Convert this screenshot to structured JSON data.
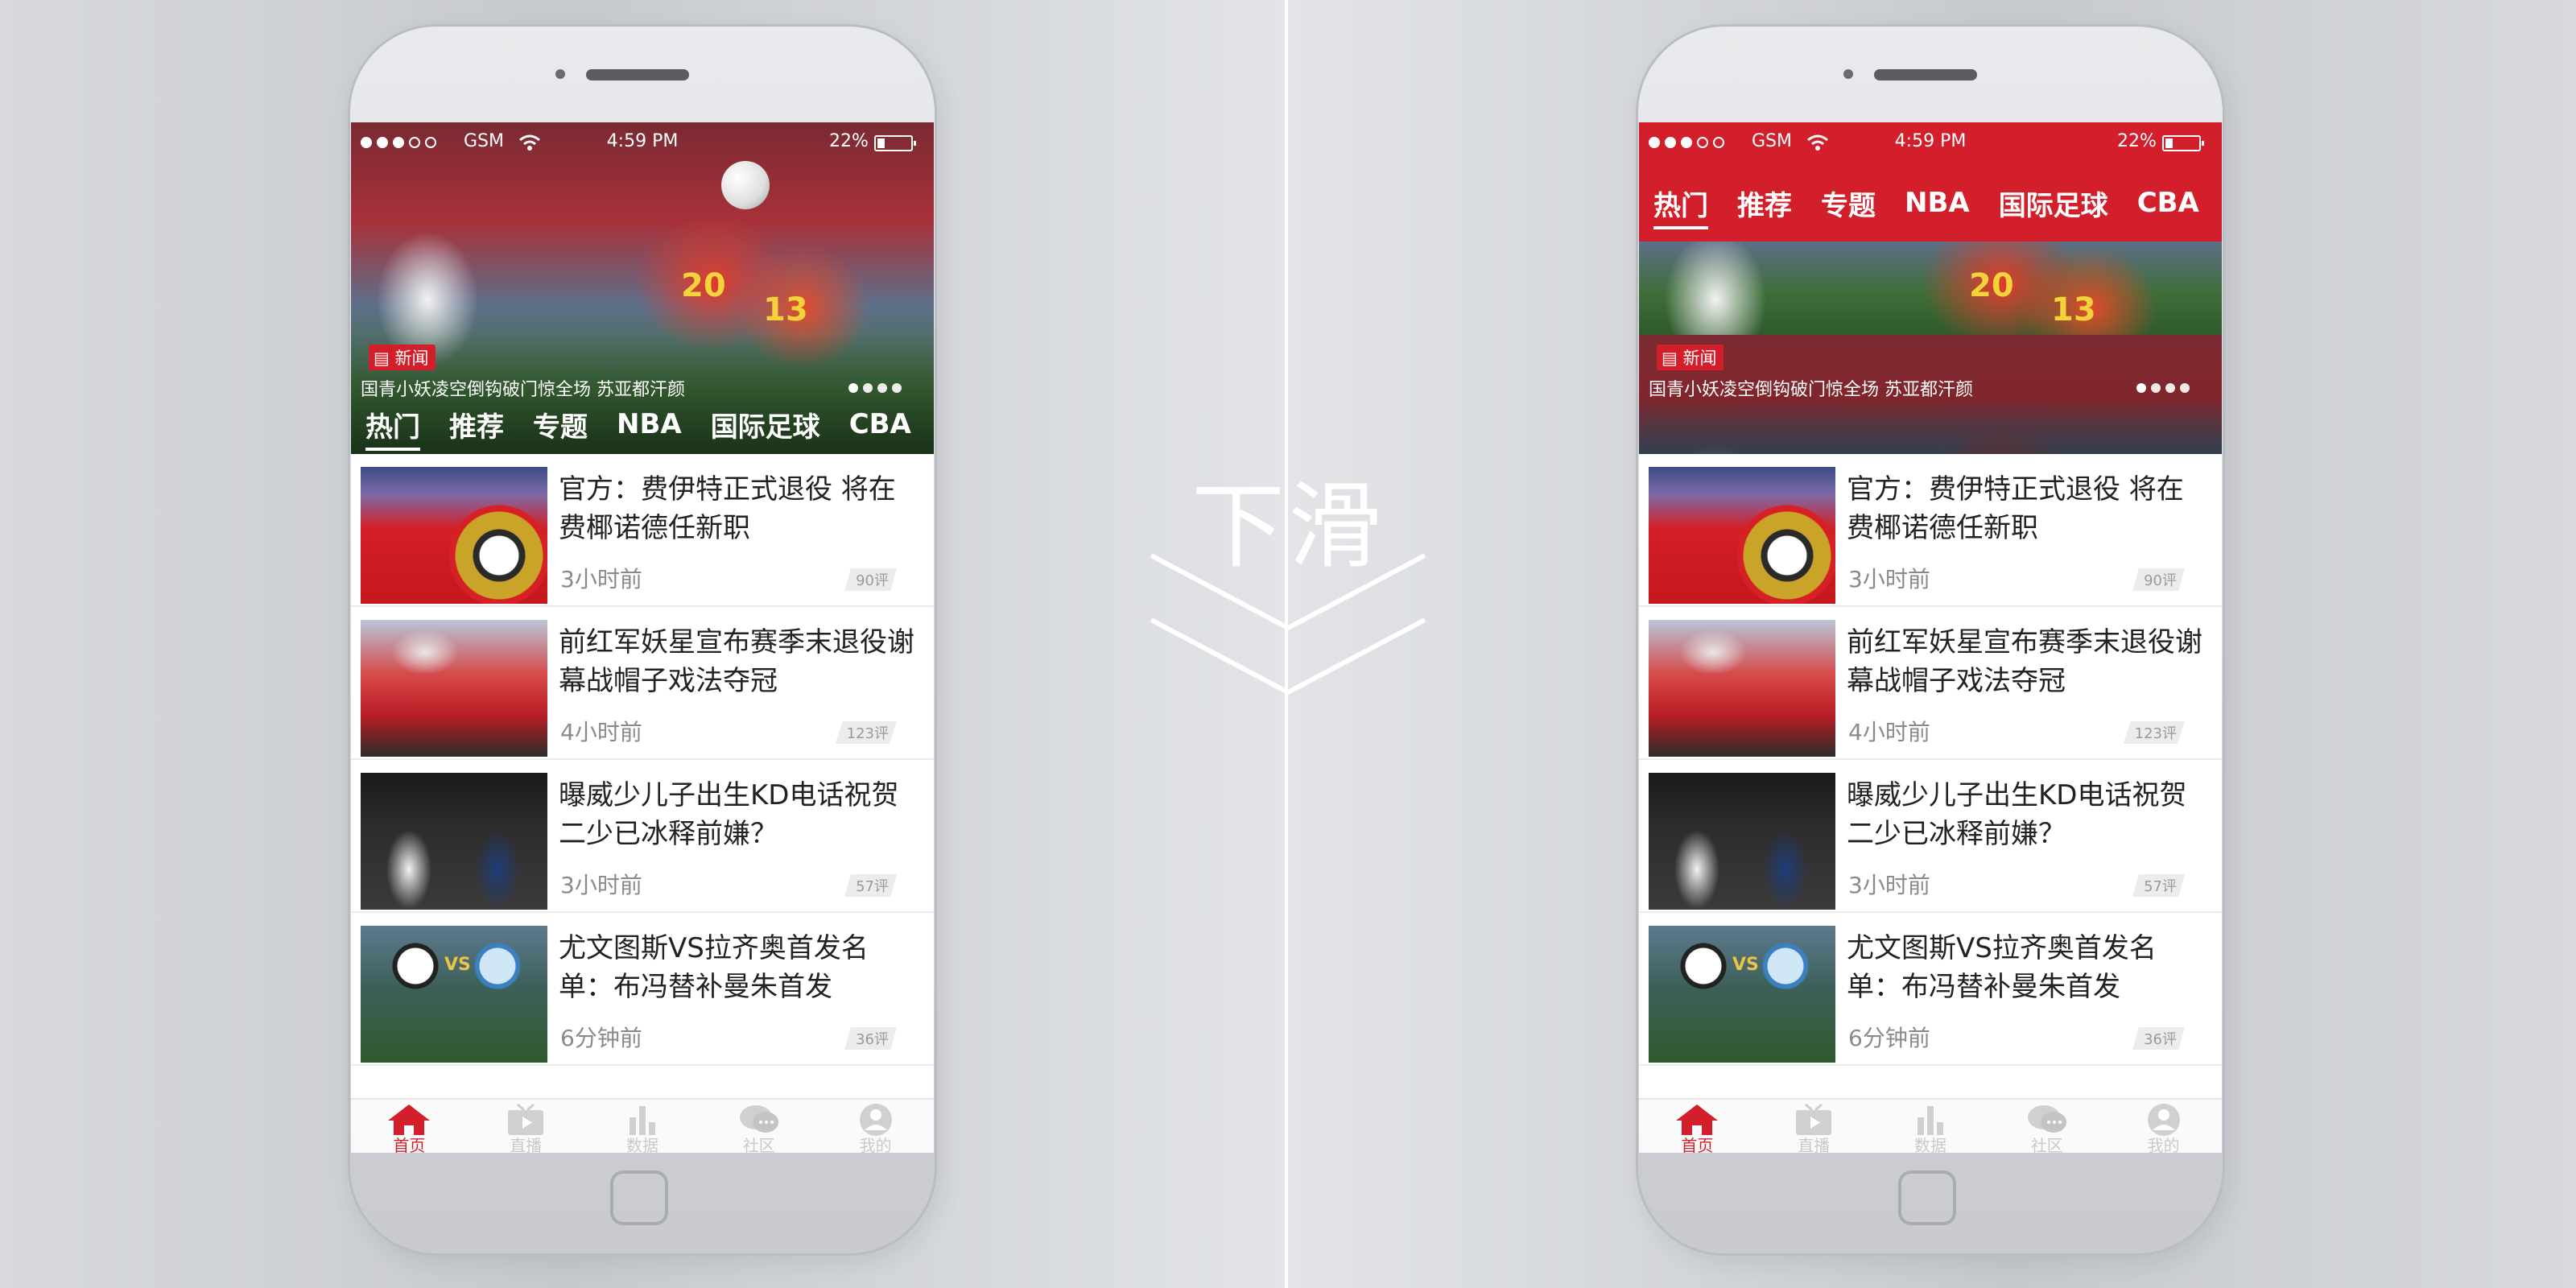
{
  "center": {
    "label": "下滑"
  },
  "status_bar": {
    "carrier": "GSM",
    "time": "4:59   PM",
    "battery": "22%",
    "battery_level": 0.22
  },
  "tabs": [
    "热门",
    "推荐",
    "专题",
    "NBA",
    "国际足球",
    "CBA"
  ],
  "active_tab": 0,
  "hero": {
    "tag": "新闻",
    "caption": "国青小妖凌空倒钩破门惊全场 苏亚都汗颜",
    "page_count": 4,
    "active_page": 0
  },
  "news": [
    {
      "title": "官方：费伊特正式退役 将在费椰诺德任新职",
      "time": "3小时前",
      "comments": "90评"
    },
    {
      "title": "前红军妖星宣布赛季末退役谢幕战帽子戏法夺冠",
      "time": "4小时前",
      "comments": "123评"
    },
    {
      "title": "曝威少儿子出生KD电话祝贺二少已冰释前嫌？",
      "time": "3小时前",
      "comments": "57评"
    },
    {
      "title": "尤文图斯VS拉齐奥首发名单：布冯替补曼朱首发",
      "time": "6分钟前",
      "comments": "36评"
    }
  ],
  "thumb_text": {
    "vs": "VS"
  },
  "bottom_nav": [
    {
      "label": "首页",
      "icon": "home-icon"
    },
    {
      "label": "直播",
      "icon": "tv-icon"
    },
    {
      "label": "数据",
      "icon": "bar-chart-icon"
    },
    {
      "label": "社区",
      "icon": "chat-icon"
    },
    {
      "label": "我的",
      "icon": "user-icon"
    }
  ],
  "colors": {
    "accent": "#d31f2b",
    "divider": "#ffffff"
  }
}
